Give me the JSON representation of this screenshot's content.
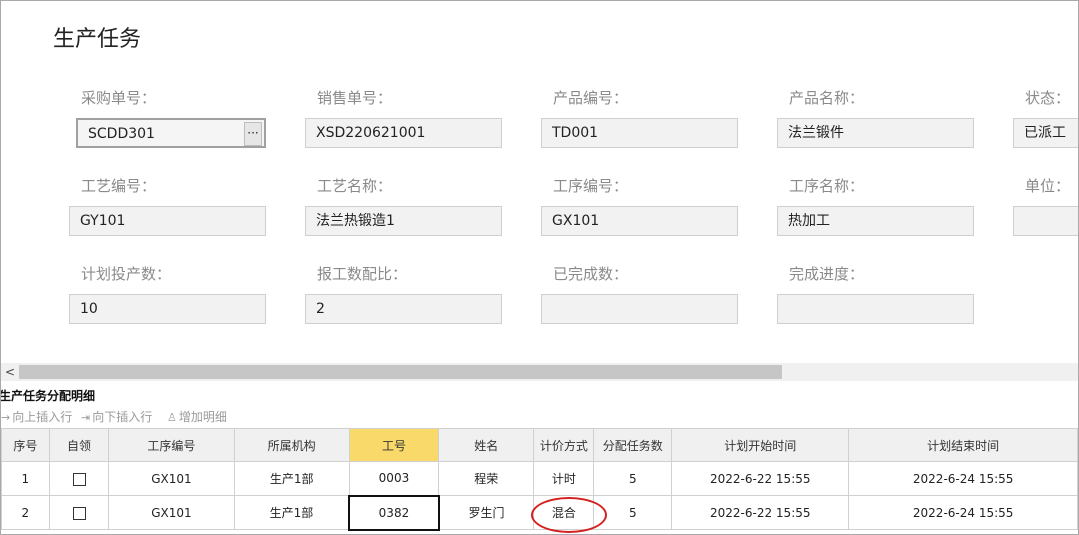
{
  "page": {
    "title": "生产任务"
  },
  "form": {
    "purchase_no_label": "采购单号：",
    "purchase_no_value": "SCDD301",
    "purchase_no_button": "···",
    "sales_no_label": "销售单号：",
    "sales_no_value": "XSD220621001",
    "product_code_label": "产品编号：",
    "product_code_value": "TD001",
    "product_name_label": "产品名称：",
    "product_name_value": "法兰锻件",
    "status_label": "状态：",
    "status_value": "已派工",
    "process_code_label": "工艺编号：",
    "process_code_value": "GY101",
    "process_name_label": "工艺名称：",
    "process_name_value": "法兰热锻造1",
    "step_code_label": "工序编号：",
    "step_code_value": "GX101",
    "step_name_label": "工序名称：",
    "step_name_value": "热加工",
    "unit_label": "单位：",
    "unit_value": "",
    "planned_qty_label": "计划投产数：",
    "planned_qty_value": "10",
    "report_ratio_label": "报工数配比：",
    "report_ratio_value": "2",
    "completed_label": "已完成数：",
    "completed_value": "",
    "progress_label": "完成进度：",
    "progress_value": ""
  },
  "detail": {
    "title": "生产任务分配明细",
    "toolbar": {
      "insert_above": "向上插入行",
      "insert_below": "向下插入行",
      "add_detail": "增加明细"
    },
    "columns": [
      "序号",
      "自领",
      "工序编号",
      "所属机构",
      "工号",
      "姓名",
      "计价方式",
      "分配任务数",
      "计划开始时间",
      "计划结束时间"
    ],
    "rows": [
      {
        "no": "1",
        "self_claim": false,
        "step_code": "GX101",
        "org": "生产1部",
        "emp_no": "0003",
        "name": "程荣",
        "pricing": "计时",
        "qty": "5",
        "start": "2022-6-22 15:55",
        "end": "2022-6-24 15:55"
      },
      {
        "no": "2",
        "self_claim": false,
        "step_code": "GX101",
        "org": "生产1部",
        "emp_no": "0382",
        "name": "罗生门",
        "pricing": "混合",
        "qty": "5",
        "start": "2022-6-22 15:55",
        "end": "2022-6-24 15:55"
      }
    ]
  },
  "colors": {
    "highlight_header": "#f9d96a",
    "annotation_circle": "#d32020"
  }
}
